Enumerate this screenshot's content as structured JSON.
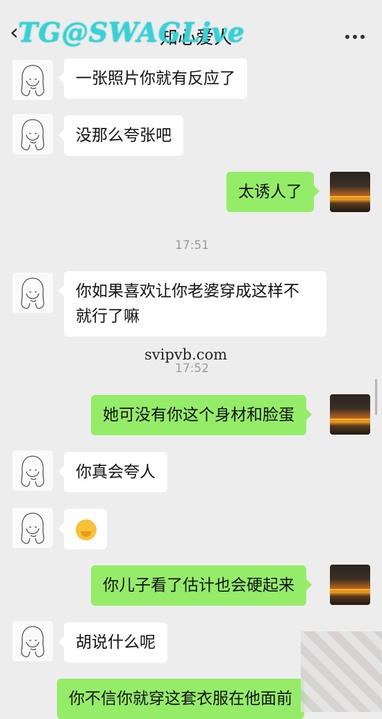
{
  "header": {
    "title": "知心爱人",
    "back_icon": "chevron-left-icon",
    "more_icon": "more-dots-icon"
  },
  "watermark": {
    "text": "TG@SWAGLive",
    "sub": "Live"
  },
  "site_mark": "svipvb.com",
  "messages": [
    {
      "side": "left",
      "text": "一张照片你就有反应了"
    },
    {
      "side": "left",
      "text": "没那么夸张吧"
    },
    {
      "side": "right",
      "text": "太诱人了"
    },
    {
      "type": "time",
      "text": "17:51"
    },
    {
      "side": "left",
      "text": "你如果喜欢让你老婆穿成这样不",
      "text2": "就行了嘛"
    },
    {
      "type": "time",
      "text": "17:52"
    },
    {
      "side": "right",
      "text": "她可没有你这个身材和脸蛋"
    },
    {
      "side": "left",
      "text": "你真会夸人"
    },
    {
      "side": "left",
      "emoji": "thinking-face-emoji"
    },
    {
      "side": "right",
      "text": "你儿子看了估计也会硬起来"
    },
    {
      "side": "left",
      "text": "胡说什么呢"
    },
    {
      "side": "right",
      "text": "你不信你就穿这套衣服在他面前"
    }
  ],
  "colors": {
    "background": "#ededed",
    "left_bubble": "#ffffff",
    "right_bubble": "#95ec69",
    "time": "#9b9b9b"
  }
}
